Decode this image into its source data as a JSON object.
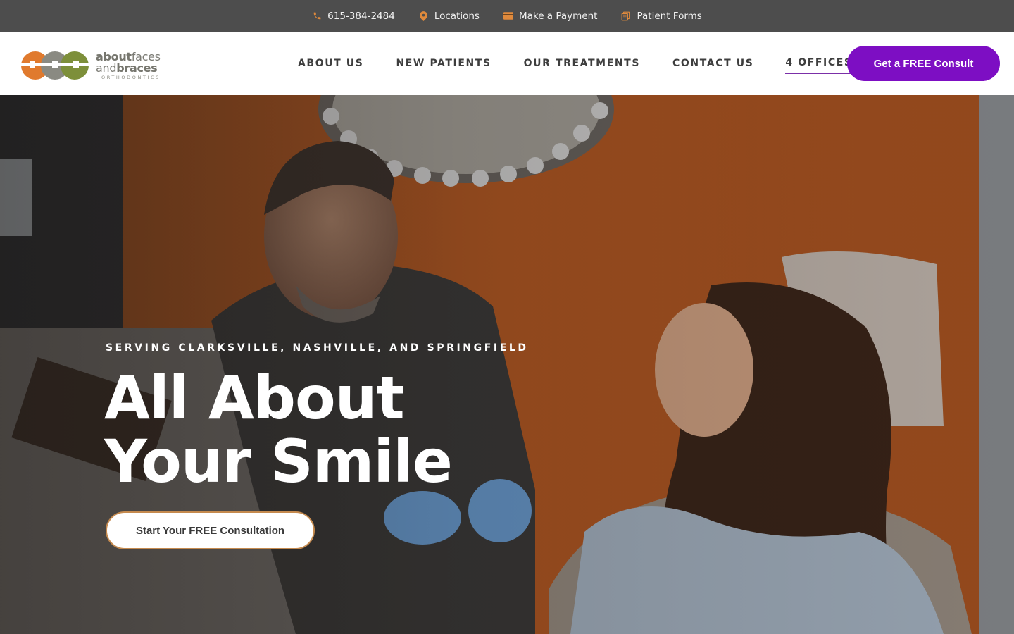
{
  "topbar": {
    "phone": "615-384-2484",
    "locations": "Locations",
    "payment": "Make a Payment",
    "forms": "Patient Forms",
    "icons": [
      "phone-icon",
      "map-pin-icon",
      "credit-card-icon",
      "forms-icon"
    ],
    "icon_color": "#e08a3c"
  },
  "logo": {
    "line1_bold": "about",
    "line1_rest": "faces",
    "line2_light": "and",
    "line2_bold": "braces",
    "line3": "ORTHODONTICS",
    "colors": [
      "#e07a2e",
      "#8a8a82",
      "#8a9a3c",
      "#7d8f3a"
    ]
  },
  "nav": {
    "items": [
      "ABOUT US",
      "NEW PATIENTS",
      "OUR TREATMENTS",
      "CONTACT US",
      "4 OFFICES"
    ],
    "cta": "Get a FREE Consult",
    "accent": "#7d0ec3"
  },
  "hero": {
    "eyebrow": "SERVING CLARKSVILLE, NASHVILLE, AND SPRINGFIELD",
    "title_line1": "All About",
    "title_line2": "Your Smile",
    "button": "Start Your FREE Consultation",
    "button_border": "#c58a4e"
  }
}
